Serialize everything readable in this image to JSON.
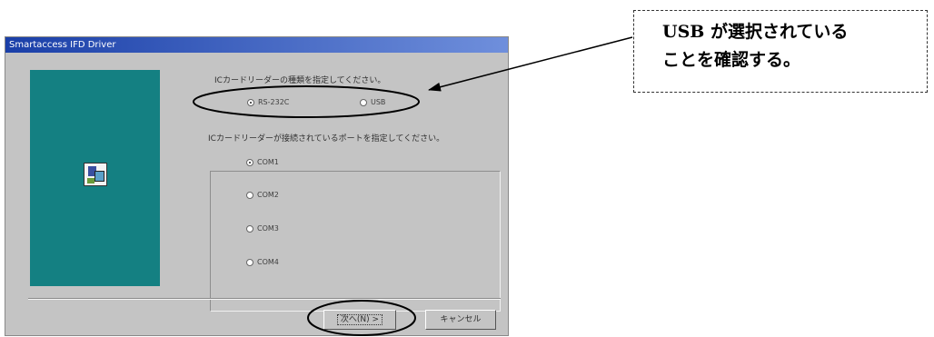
{
  "dialog": {
    "title": "Smartaccess IFD Driver",
    "reader_prompt": "ICカードリーダーの種類を指定してください。",
    "reader_options": [
      {
        "label": "RS-232C",
        "selected": true
      },
      {
        "label": "USB",
        "selected": false
      }
    ],
    "port_prompt": "ICカードリーダーが接続されているポートを指定してください。",
    "ports": [
      {
        "label": "COM1",
        "selected": true
      },
      {
        "label": "COM2",
        "selected": false
      },
      {
        "label": "COM3",
        "selected": false
      },
      {
        "label": "COM4",
        "selected": false
      }
    ],
    "next_label": "次へ(N) >",
    "cancel_label": "キャンセル"
  },
  "callout": {
    "line1": "USB が選択されている",
    "line2": "ことを確認する。"
  },
  "colors": {
    "dialog_bg": "#c4c4c4",
    "side_panel": "#148082",
    "titlebar": "#1a3fa8"
  }
}
